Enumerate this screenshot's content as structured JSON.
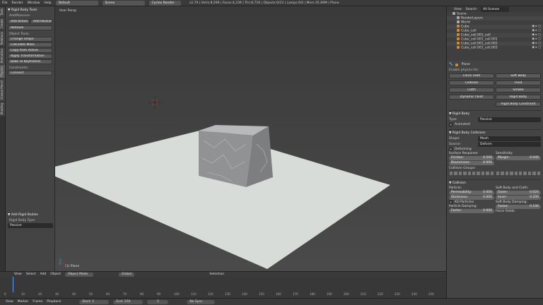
{
  "topbar": {
    "menus": [
      "File",
      "Render",
      "Window",
      "Help"
    ],
    "layout": "Default",
    "scene": "Scene",
    "engine": "Cycles Render",
    "stats": "v2.79 | Verts:8,596 | Faces:4,239 | Tris:8,716 | Objects:0/23 | Lamps:0/0 | Mem:35.89M | Plane"
  },
  "tabs": [
    "Tools",
    "Create",
    "Relations",
    "Animation",
    "Physics",
    "Grease Pencil",
    "Shading"
  ],
  "tool_panel": {
    "title": "▼ Rigid Body Tools",
    "add_remove": "Add/Remove:",
    "add_active": "Add Active",
    "add_passive": "Add Passive",
    "remove": "Remove",
    "object_tools": "Object Tools:",
    "change_shape": "Change Shape",
    "calculate_mass": "Calculate Mass",
    "copy_from_active": "Copy from Active",
    "apply_transformation": "Apply Transformation",
    "bake_to_keyframes": "Bake To Keyframes",
    "constraints": "Constraints:",
    "connect": "Connect"
  },
  "operator_redo": {
    "title": "▼ Add Rigid Bodies",
    "type_label": "Rigid Body Type:",
    "type_value": "Passive"
  },
  "viewport": {
    "label": "User Persp",
    "object_label": "(1) Plane"
  },
  "view_header": {
    "items": [
      "View",
      "Select",
      "Add",
      "Object"
    ],
    "mode": "Object Mode",
    "orientation": "Global",
    "selection": "Selection"
  },
  "timeline": {
    "ticks": [
      "0",
      "10",
      "20",
      "30",
      "40",
      "50",
      "60",
      "70",
      "80",
      "90",
      "100",
      "110",
      "120",
      "130",
      "140",
      "150",
      "160",
      "170",
      "180",
      "190",
      "200",
      "210",
      "220",
      "230",
      "240",
      "250"
    ]
  },
  "bottombar": {
    "items": [
      "View",
      "Marker",
      "Frame",
      "Playback"
    ],
    "start": "Start:",
    "start_val": "1",
    "end": "End:",
    "end_val": "250",
    "current": "5",
    "sync": "No Sync"
  },
  "outliner": {
    "header": [
      "View",
      "Search",
      "All Scenes"
    ],
    "rows": [
      {
        "label": "Scene",
        "indent": 0
      },
      {
        "label": "RenderLayers",
        "indent": 1
      },
      {
        "label": "World",
        "indent": 1
      },
      {
        "label": "Cube",
        "indent": 1
      },
      {
        "label": "Cube_cell",
        "indent": 1
      },
      {
        "label": "Cube_cell.001_cell",
        "indent": 1
      },
      {
        "label": "Cube_cell.001_cell.001",
        "indent": 1
      },
      {
        "label": "Cube_cell.001_cell.002",
        "indent": 1
      },
      {
        "label": "Cube_cell.001_cell.003",
        "indent": 1
      }
    ]
  },
  "properties": {
    "object_name": "Plane",
    "enable_physics": "Enable physics for:",
    "physics_buttons": [
      "Force Field",
      "Soft Body",
      "Collision",
      "Fluid",
      "Cloth",
      "Smoke",
      "Dynamic Paint",
      "Rigid Body",
      "",
      "Rigid Body Constraint"
    ],
    "rigid_body": "▼ Rigid Body",
    "type_label": "Type:",
    "type_value": "Passive",
    "animated": "Animated",
    "collisions": "▼ Rigid Body Collisions",
    "shape_label": "Shape:",
    "shape_value": "Mesh",
    "source_label": "Source:",
    "source_value": "Deform",
    "deforming": "Deforming",
    "surface_response": "Surface Response:",
    "friction_label": "Friction:",
    "friction_value": "0.500",
    "bounciness_label": "Bounciness:",
    "bounciness_value": "0.000",
    "sensitivity": "Sensitivity:",
    "margin_label": "Margin:",
    "margin_value": "0.040",
    "collision_groups": "Collision Groups:",
    "collision": "▼ Collision",
    "particle": "Particle:",
    "permeability_label": "Permeability:",
    "permeability_value": "0.000",
    "stickiness_label": "Stickiness:",
    "stickiness_value": "0.000",
    "kill_particles": "Kill Particles",
    "particle_damping": "Particle Damping:",
    "factor_label": "Factor:",
    "factor_value": "0.000",
    "softbody_cloth": "Soft Body and Cloth:",
    "outer_label": "Outer:",
    "outer_value": "0.020",
    "inner_label": "Inner:",
    "inner_value": "0.200",
    "softbody_damping": "Soft Body Damping:",
    "sb_factor_label": "Factor:",
    "sb_factor_value": "0.100",
    "force_fields": "Force Fields:"
  },
  "colors": {
    "accent_select": "#5a6b80",
    "object_orange": "#d08a2a",
    "plane": "#d8dcd9",
    "cube": "#8e9092"
  }
}
